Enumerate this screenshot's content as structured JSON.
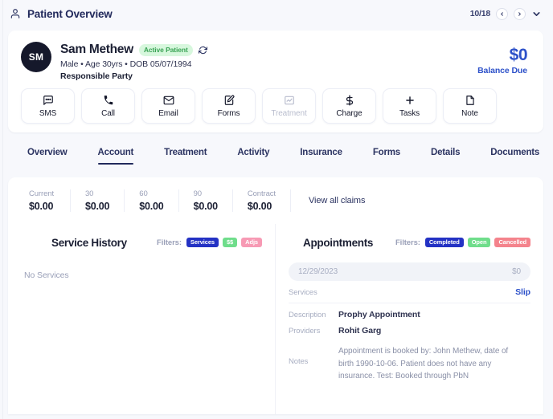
{
  "header": {
    "title": "Patient Overview",
    "person_icon": "person-icon",
    "page_count": "10/18",
    "prev_icon": "chevron-left-icon",
    "next_icon": "chevron-right-icon",
    "expand_icon": "chevron-down-icon"
  },
  "patient": {
    "initials": "SM",
    "name": "Sam Methew",
    "status": "Active Patient",
    "status_color": "#3aa355",
    "status_bg": "#d7f7dd",
    "sync_icon": "sync-icon",
    "meta": "Male • Age 30yrs • DOB 05/07/1994",
    "responsible": "Responsible Party",
    "balance_amount": "$0",
    "balance_label": "Balance Due",
    "balance_color": "#2d51c9"
  },
  "actions": [
    {
      "label": "SMS",
      "icon": "sms-icon",
      "disabled": false
    },
    {
      "label": "Call",
      "icon": "phone-icon",
      "disabled": false
    },
    {
      "label": "Email",
      "icon": "envelope-icon",
      "disabled": false
    },
    {
      "label": "Forms",
      "icon": "form-edit-icon",
      "disabled": false
    },
    {
      "label": "Treatment",
      "icon": "treatment-icon",
      "disabled": true
    },
    {
      "label": "Charge",
      "icon": "dollar-icon",
      "disabled": false
    },
    {
      "label": "Tasks",
      "icon": "plus-icon",
      "disabled": false
    },
    {
      "label": "Note",
      "icon": "note-icon",
      "disabled": false
    }
  ],
  "tabs": [
    {
      "label": "Overview",
      "active": false
    },
    {
      "label": "Account",
      "active": true
    },
    {
      "label": "Treatment",
      "active": false
    },
    {
      "label": "Activity",
      "active": false
    },
    {
      "label": "Insurance",
      "active": false
    },
    {
      "label": "Forms",
      "active": false
    },
    {
      "label": "Details",
      "active": false
    },
    {
      "label": "Documents",
      "active": false
    }
  ],
  "aging": {
    "cells": [
      {
        "label": "Current",
        "value": "$0.00"
      },
      {
        "label": "30",
        "value": "$0.00"
      },
      {
        "label": "60",
        "value": "$0.00"
      },
      {
        "label": "90",
        "value": "$0.00"
      },
      {
        "label": "Contract",
        "value": "$0.00"
      }
    ],
    "view_all_claims": "View all claims"
  },
  "service_history": {
    "title": "Service History",
    "filters_label": "Filters:",
    "chips": [
      {
        "label": "Services",
        "color": "#2432c4"
      },
      {
        "label": "$$",
        "color": "#6fdd8b"
      },
      {
        "label": "Adjs",
        "color": "#f79ab4"
      }
    ],
    "empty_text": "No Services"
  },
  "appointments": {
    "title": "Appointments",
    "filters_label": "Filters:",
    "chips": [
      {
        "label": "Completed",
        "color": "#2432c4"
      },
      {
        "label": "Open",
        "color": "#6fdd8b"
      },
      {
        "label": "Cancelled",
        "color": "#f4838c"
      }
    ],
    "row": {
      "date": "12/29/2023",
      "amount": "$0"
    },
    "details": {
      "services_key": "Services",
      "slip_link": "Slip",
      "description_key": "Description",
      "description_value": "Prophy Appointment",
      "providers_key": "Providers",
      "providers_value": "Rohit Garg",
      "notes_key": "Notes",
      "notes_value": "Appointment is booked by: John Methew, date of birth 1990-10-06. Patient does not have any insurance. Test: Booked through PbN"
    }
  }
}
